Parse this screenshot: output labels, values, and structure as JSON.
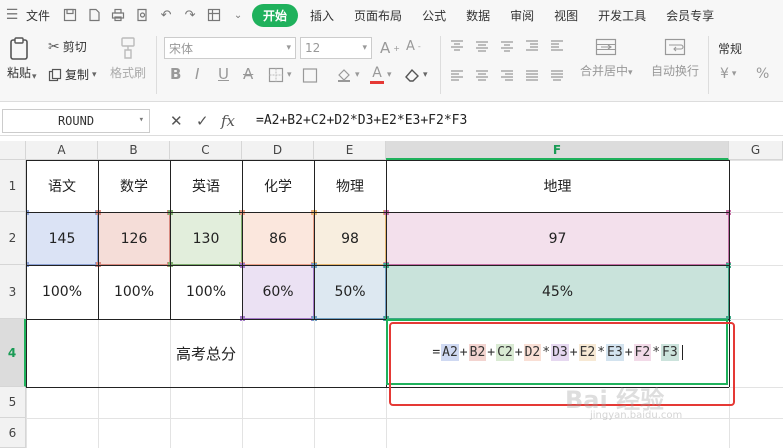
{
  "menubar": {
    "file": "文件",
    "tabs": [
      {
        "label": "开始",
        "active": true
      },
      {
        "label": "插入",
        "active": false
      },
      {
        "label": "页面布局",
        "active": false
      },
      {
        "label": "公式",
        "active": false
      },
      {
        "label": "数据",
        "active": false
      },
      {
        "label": "审阅",
        "active": false
      },
      {
        "label": "视图",
        "active": false
      },
      {
        "label": "开发工具",
        "active": false
      },
      {
        "label": "会员专享",
        "active": false
      }
    ]
  },
  "ribbon": {
    "paste": "粘贴",
    "cut": "剪切",
    "copy": "复制",
    "format_painter": "格式刷",
    "font_name": "宋体",
    "font_size": "12",
    "merge_center": "合并居中",
    "wrap_text": "自动换行",
    "number_format": "常规"
  },
  "formula_bar": {
    "name_box": "ROUND",
    "fx": "fx",
    "formula": "=A2+B2+C2+D2*D3+E2*E3+F2*F3"
  },
  "columns": [
    "A",
    "B",
    "C",
    "D",
    "E",
    "F",
    "G"
  ],
  "rows": [
    "1",
    "2",
    "3",
    "4",
    "5",
    "6"
  ],
  "sheet": {
    "row1": [
      "语文",
      "数学",
      "英语",
      "化学",
      "物理",
      "地理"
    ],
    "row2": [
      "145",
      "126",
      "130",
      "86",
      "98",
      "97"
    ],
    "row3": [
      "100%",
      "100%",
      "100%",
      "60%",
      "50%",
      "45%"
    ],
    "row4_label": "高考总分"
  },
  "editing": {
    "tokens": [
      {
        "t": "=",
        "c": ""
      },
      {
        "t": "A2",
        "c": "#cfd9f2"
      },
      {
        "t": "+",
        "c": ""
      },
      {
        "t": "B2",
        "c": "#f3d4d0"
      },
      {
        "t": "+",
        "c": ""
      },
      {
        "t": "C2",
        "c": "#d9ead3"
      },
      {
        "t": "+",
        "c": ""
      },
      {
        "t": "D2",
        "c": "#f9dfd5"
      },
      {
        "t": "*",
        "c": ""
      },
      {
        "t": "D3",
        "c": "#e6d8f0"
      },
      {
        "t": "+",
        "c": ""
      },
      {
        "t": "E2",
        "c": "#f7e9d4"
      },
      {
        "t": "*",
        "c": ""
      },
      {
        "t": "E3",
        "c": "#d3e3ef"
      },
      {
        "t": "+",
        "c": ""
      },
      {
        "t": "F2",
        "c": "#f2dae8"
      },
      {
        "t": "*",
        "c": ""
      },
      {
        "t": "F3",
        "c": "#cce3dc"
      }
    ]
  },
  "watermark": {
    "main": "Bai 经验",
    "sub": "jingyan.baidu.com"
  },
  "colors": {
    "accent": "#1fb15c",
    "annotation_red": "#e53935"
  }
}
